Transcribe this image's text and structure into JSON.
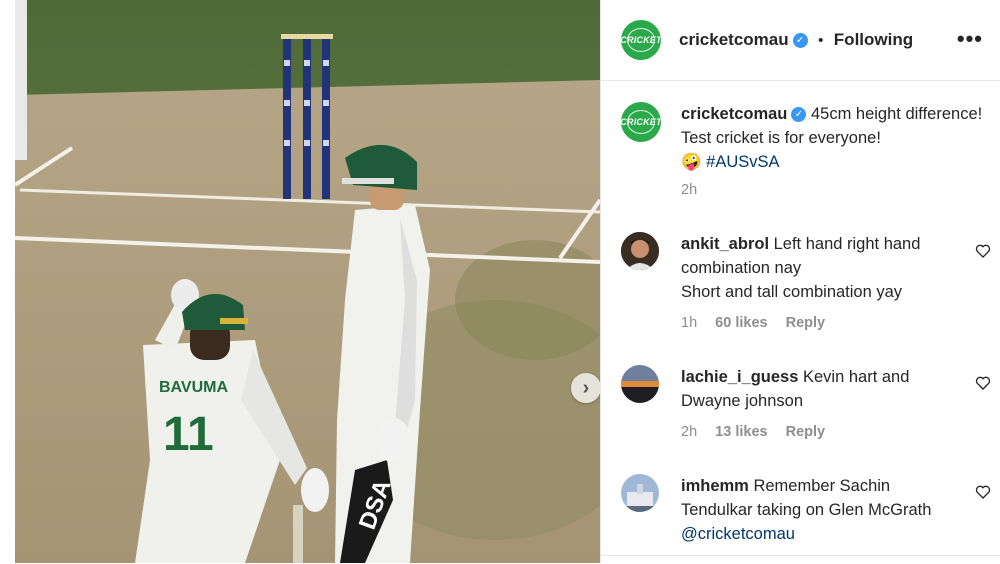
{
  "post": {
    "account": "cricketcomau",
    "follow_status": "Following",
    "more_icon": "more-options-icon",
    "logo_text": "CRICKET",
    "caption_text": "45cm height difference! Test cricket is for everyone!",
    "caption_emoji": "🤪",
    "caption_hashtag": "#AUSvSA",
    "caption_time": "2h",
    "photo": {
      "jersey_name": "BAVUMA",
      "jersey_number": "11",
      "bat_brand": "DSA"
    }
  },
  "comments": [
    {
      "user": "ankit_abrol",
      "text": "Left hand right hand combination nay",
      "text2": "Short and tall combination yay",
      "time": "1h",
      "likes": "60 likes",
      "reply": "Reply"
    },
    {
      "user": "lachie_i_guess",
      "text": "Kevin hart and Dwayne johnson",
      "time": "2h",
      "likes": "13 likes",
      "reply": "Reply"
    },
    {
      "user": "imhemm",
      "text": "Remember Sachin Tendulkar taking on Glen McGrath",
      "mention": "@cricketcomau"
    }
  ],
  "colors": {
    "brand_green": "#2ba84a",
    "verified_blue": "#3897f0",
    "link_blue": "#00376b",
    "muted": "#8e8e8e"
  }
}
